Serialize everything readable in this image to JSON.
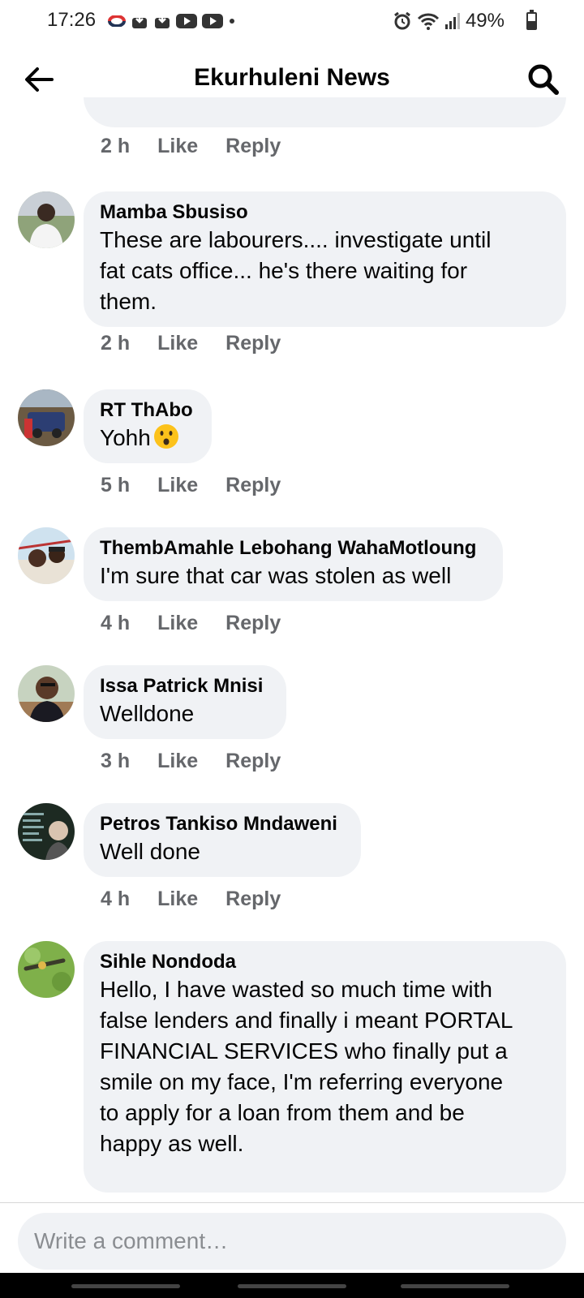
{
  "status_bar": {
    "time": "17:26",
    "battery_text": "49%",
    "battery_level": 0.49,
    "icons_left": [
      "sync-icon",
      "download-icon",
      "download-icon",
      "youtube-icon",
      "youtube-icon",
      "dot-icon"
    ],
    "icons_right": [
      "alarm-icon",
      "wifi-icon",
      "signal-icon",
      "battery-icon"
    ]
  },
  "header": {
    "title": "Ekurhuleni News",
    "back_icon": "back-arrow-icon",
    "search_icon": "search-icon"
  },
  "partial_comment": {
    "time": "2 h",
    "like_label": "Like",
    "reply_label": "Reply"
  },
  "comments": [
    {
      "author": "Mamba Sbusiso",
      "lines": [
        "These are labourers.... investigate until",
        "fat cats office... he's there waiting for",
        "them."
      ],
      "time": "2 h",
      "like_label": "Like",
      "reply_label": "Reply"
    },
    {
      "author": "RT ThAbo",
      "lines": [
        "Yohh"
      ],
      "emoji": "hushed-face-emoji",
      "time": "5 h",
      "like_label": "Like",
      "reply_label": "Reply"
    },
    {
      "author": "ThembAmahle Lebohang WahaMotloung",
      "lines": [
        "I'm sure that car was stolen as well"
      ],
      "time": "4 h",
      "like_label": "Like",
      "reply_label": "Reply"
    },
    {
      "author": "Issa Patrick Mnisi",
      "lines": [
        "Welldone"
      ],
      "time": "3 h",
      "like_label": "Like",
      "reply_label": "Reply"
    },
    {
      "author": "Petros Tankiso Mndaweni",
      "lines": [
        "Well done"
      ],
      "time": "4 h",
      "like_label": "Like",
      "reply_label": "Reply"
    },
    {
      "author": "Sihle Nondoda",
      "lines": [
        "Hello, I have wasted so much time with",
        "false lenders and finally i meant PORTAL",
        "FINANCIAL SERVICES who finally put a",
        "smile on my face, I'm referring everyone",
        "to apply for a loan from them and be",
        "happy as well."
      ]
    }
  ],
  "composer": {
    "placeholder": "Write a comment…"
  },
  "colors": {
    "bubble": "#f0f2f5",
    "meta_text": "#65676b",
    "text": "#050505"
  }
}
